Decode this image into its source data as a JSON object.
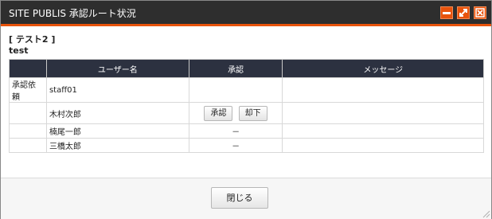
{
  "window": {
    "title": "SITE PUBLIS 承認ルート状況"
  },
  "window_controls": [
    "minimize-icon",
    "maximize-icon",
    "close-icon"
  ],
  "route": {
    "name": "[ テスト2 ]",
    "description": "test"
  },
  "table": {
    "headers": [
      "",
      "ユーザー名",
      "承認",
      "メッセージ"
    ],
    "rows": [
      {
        "label": "承認依頼",
        "user": "staff01",
        "approval": "",
        "message": ""
      },
      {
        "label": "",
        "user": "木村次郎",
        "approval": "",
        "message": ""
      },
      {
        "label": "",
        "user": "楠尾一郎",
        "approval": "－",
        "message": ""
      },
      {
        "label": "",
        "user": "三橋太郎",
        "approval": "－",
        "message": ""
      }
    ]
  },
  "actions": {
    "approve": "承認",
    "reject": "却下"
  },
  "footer": {
    "close": "閉じる"
  },
  "colors": {
    "accent": "#e8530c",
    "titlebar": "#2e2e2e",
    "table_header": "#2c3140"
  }
}
